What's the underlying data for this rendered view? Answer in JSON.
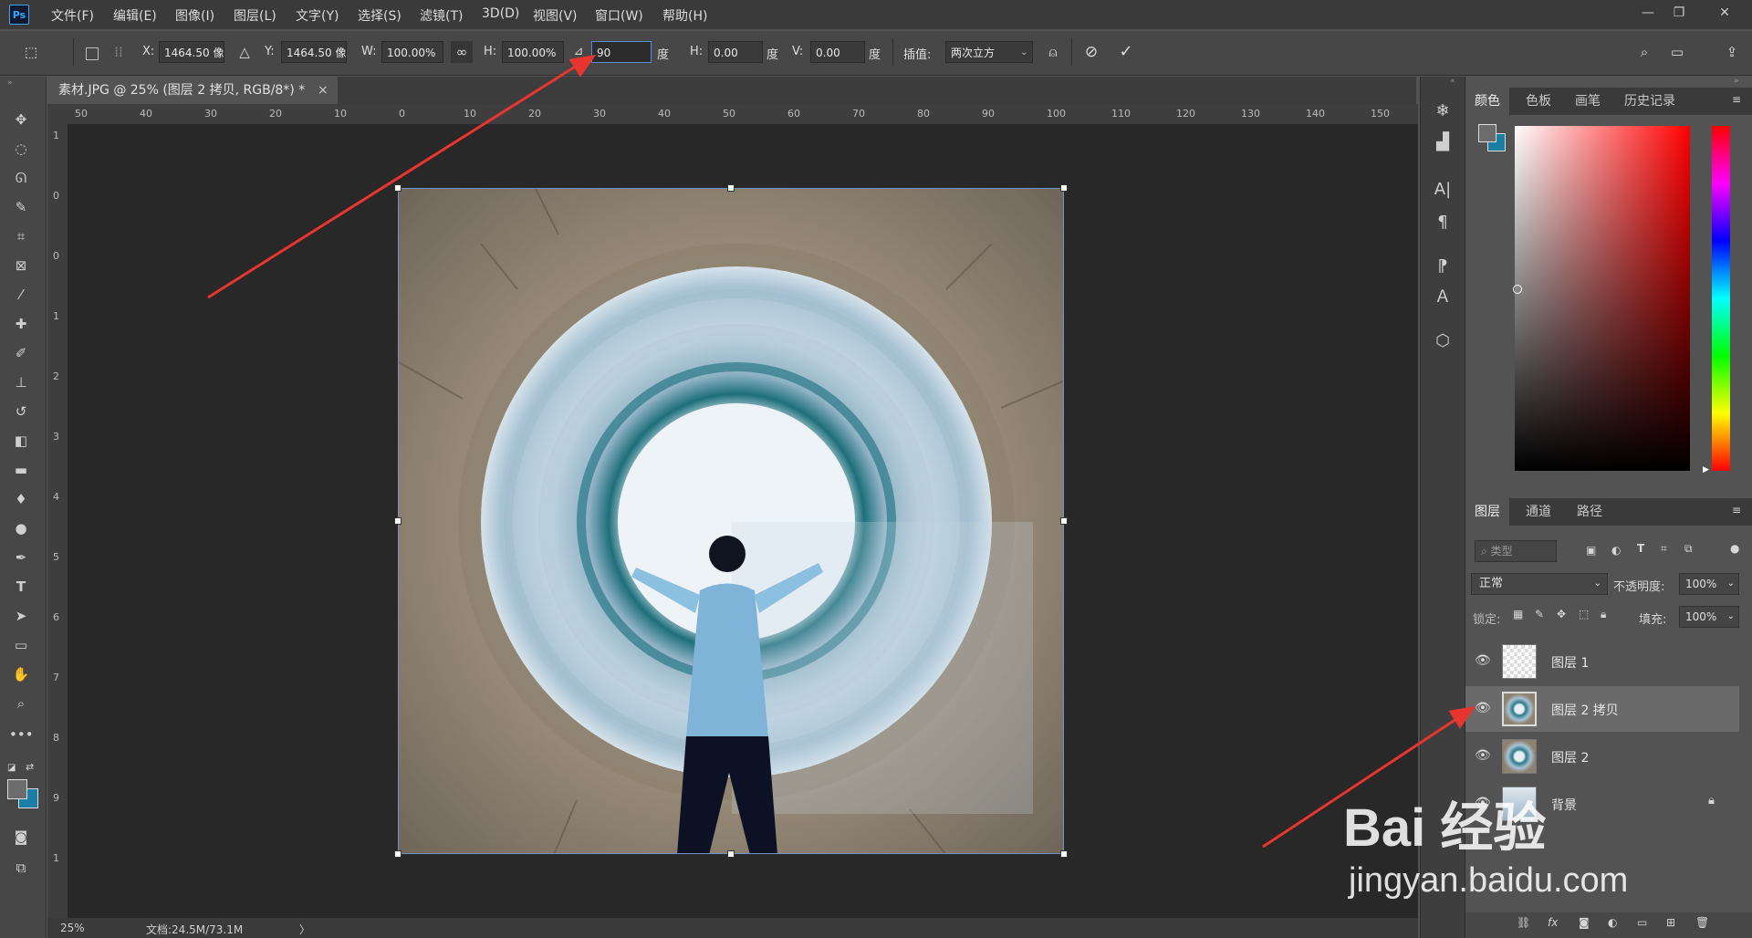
{
  "app": {
    "logo": "Ps"
  },
  "menu": [
    "文件(F)",
    "编辑(E)",
    "图像(I)",
    "图层(L)",
    "文字(Y)",
    "选择(S)",
    "滤镜(T)",
    "3D(D)",
    "视图(V)",
    "窗口(W)",
    "帮助(H)"
  ],
  "window_controls": {
    "minimize": "—",
    "restore": "❐",
    "close": "✕"
  },
  "options": {
    "x_label": "X:",
    "x_value": "1464.50 像",
    "y_label": "Y:",
    "y_value": "1464.50 像",
    "w_label": "W:",
    "w_value": "100.00%",
    "h_label": "H:",
    "h_value": "100.00%",
    "angle_value": "90",
    "angle_unit": "度",
    "hskew_label": "H:",
    "hskew_value": "0.00",
    "hskew_unit": "度",
    "vskew_label": "V:",
    "vskew_value": "0.00",
    "vskew_unit": "度",
    "interp_label": "插值:",
    "interp_value": "两次立方"
  },
  "document": {
    "tab_title": "素材.JPG @ 25% (图层 2 拷贝, RGB/8*) *",
    "close": "×",
    "ruler_top": [
      "50",
      "40",
      "30",
      "20",
      "10",
      "0",
      "10",
      "20",
      "30",
      "40",
      "50",
      "60",
      "70",
      "80",
      "90",
      "100",
      "110",
      "120",
      "130",
      "140",
      "150"
    ],
    "ruler_left": [
      "1",
      "0",
      "0",
      "1",
      "2",
      "3",
      "4",
      "5",
      "6",
      "7",
      "8",
      "9",
      "1"
    ]
  },
  "status": {
    "zoom": "25%",
    "doc": "文档:24.5M/73.1M",
    "more": "〉"
  },
  "color_panel": {
    "tabs": [
      "颜色",
      "色板",
      "画笔",
      "历史记录"
    ]
  },
  "layers_panel": {
    "tabs": [
      "图层",
      "通道",
      "路径"
    ],
    "filter_placeholder": "类型",
    "blend_mode": "正常",
    "opacity_label": "不透明度:",
    "opacity_value": "100%",
    "lock_label": "锁定:",
    "fill_label": "填充:",
    "fill_value": "100%",
    "layers": [
      {
        "name": "图层 1",
        "selected": false,
        "locked": false
      },
      {
        "name": "图层 2 拷贝",
        "selected": true,
        "locked": false
      },
      {
        "name": "图层 2",
        "selected": false,
        "locked": false
      },
      {
        "name": "背景",
        "selected": false,
        "locked": true
      }
    ],
    "bottom_icons": [
      "link-icon",
      "fx-icon",
      "mask-icon",
      "adjustment-icon",
      "folder-icon",
      "new-layer-icon",
      "trash-icon"
    ]
  },
  "watermark": {
    "brand": "Bai 经验",
    "url": "jingyan.baidu.com"
  },
  "colors": {
    "accent": "#31a8ff",
    "arrow": "#e8352e",
    "selection": "#6d93c9",
    "foreground": "#1a7ea6"
  }
}
